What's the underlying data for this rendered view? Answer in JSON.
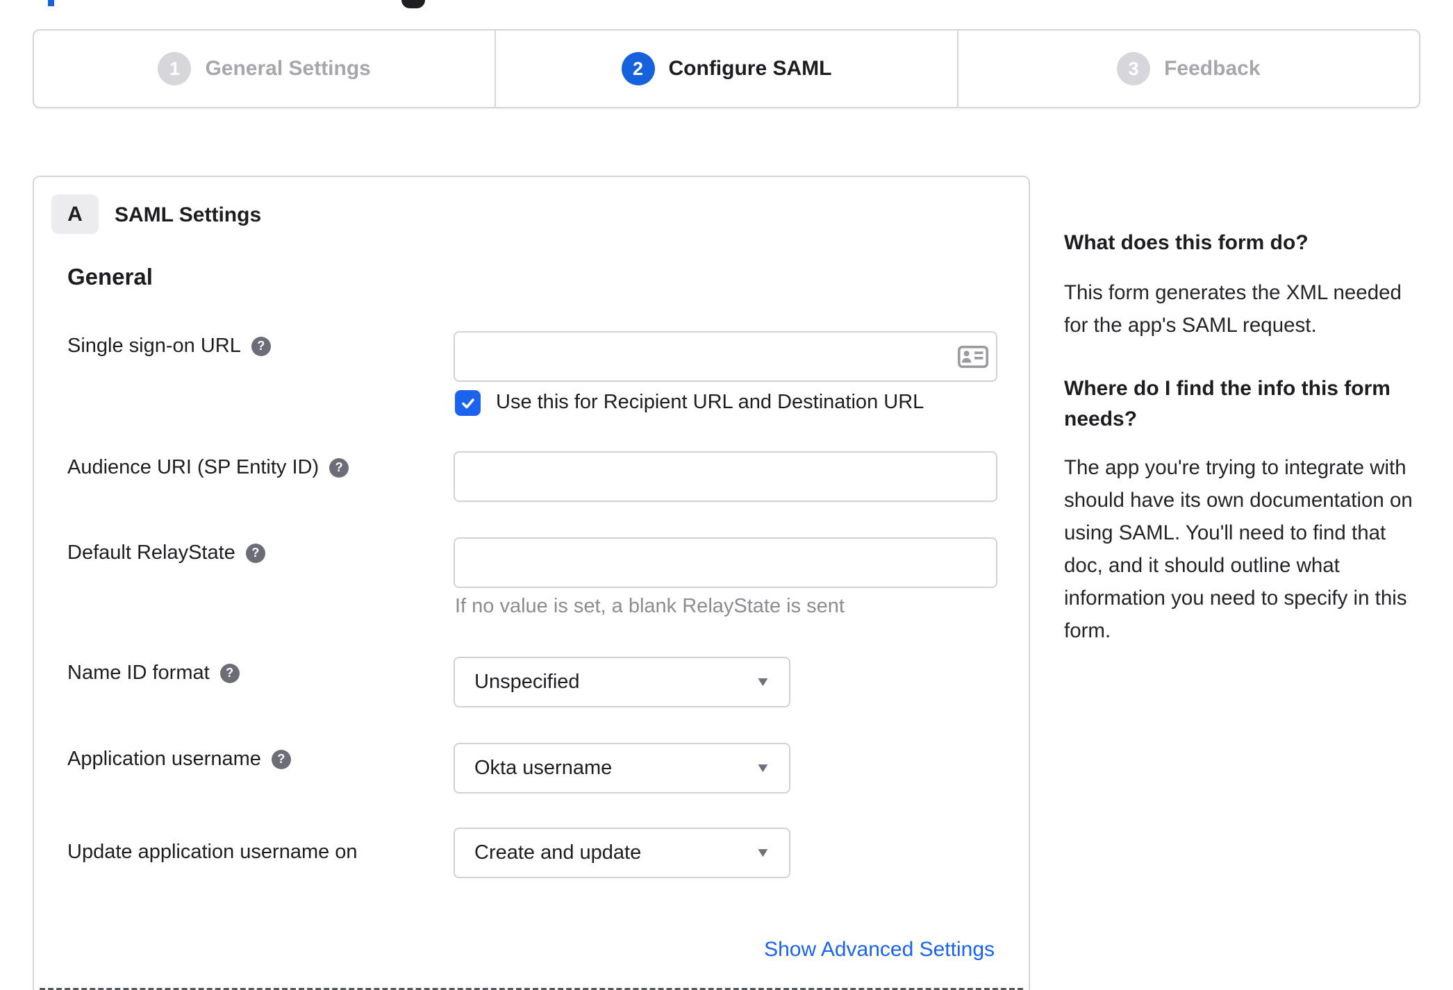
{
  "colors": {
    "accent_blue": "#1662dd",
    "checkbox_blue": "#1b63ec",
    "link_blue": "#1b63ec",
    "border_gray": "#d6d6da",
    "inactive_step_gray": "#a6a6ad",
    "help_icon_gray": "#6d6d78",
    "text_dark": "#1d1d21"
  },
  "icons": {
    "help_glyph": "?",
    "caret_glyph": "▼"
  },
  "stepper": {
    "steps": [
      {
        "number": "1",
        "label": "General Settings",
        "state": "inactive"
      },
      {
        "number": "2",
        "label": "Configure SAML",
        "state": "active"
      },
      {
        "number": "3",
        "label": "Feedback",
        "state": "inactive"
      }
    ]
  },
  "saml_card": {
    "section_letter": "A",
    "section_title": "SAML Settings",
    "group_heading": "General",
    "sso": {
      "label": "Single sign-on URL",
      "value": "",
      "checkbox_checked": true,
      "checkbox_label": "Use this for Recipient URL and Destination URL"
    },
    "audience": {
      "label": "Audience URI (SP Entity ID)",
      "value": ""
    },
    "relay_state": {
      "label": "Default RelayState",
      "value": "",
      "helper": "If no value is set, a blank RelayState is sent"
    },
    "name_id_format": {
      "label": "Name ID format",
      "value": "Unspecified"
    },
    "application_username": {
      "label": "Application username",
      "value": "Okta username"
    },
    "update_application_username": {
      "label": "Update application username on",
      "value": "Create and update"
    },
    "advanced_link": "Show Advanced Settings"
  },
  "help_panel": {
    "q1": "What does this form do?",
    "a1": "This form generates the XML needed\nfor the app's SAML request.",
    "q2": "Where do I find the info this form\nneeds?",
    "a2": "The app you're trying to integrate with\nshould have its own documentation on\nusing SAML. You'll need to find that\ndoc, and it should outline what\ninformation you need to specify in this\nform."
  }
}
